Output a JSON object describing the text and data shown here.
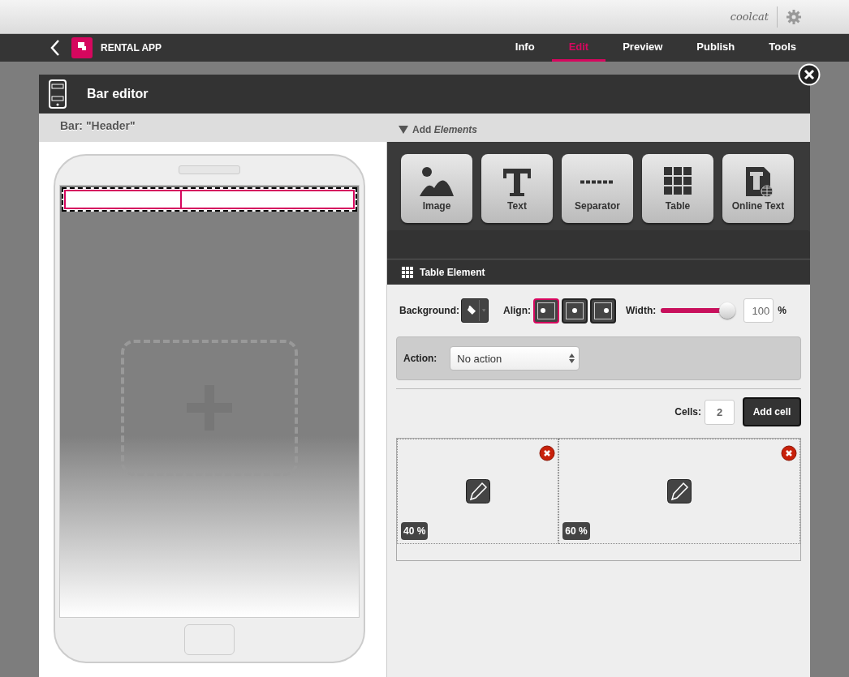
{
  "top_bar": {
    "user": "coolcat"
  },
  "app_bar": {
    "title": "RENTAL APP",
    "tabs": [
      {
        "label": "Info",
        "selected": false
      },
      {
        "label": "Edit",
        "selected": true
      },
      {
        "label": "Preview",
        "selected": false
      },
      {
        "label": "Publish",
        "selected": false
      },
      {
        "label": "Tools",
        "selected": false
      }
    ]
  },
  "editor": {
    "title": "Bar editor",
    "bar_label": "Bar: \"Header\"",
    "add_elements": "Add *Elements*",
    "elements": [
      {
        "kind": "image",
        "label": "Image"
      },
      {
        "kind": "text",
        "label": "Text"
      },
      {
        "kind": "separator",
        "label": "Separator"
      },
      {
        "kind": "table",
        "label": "Table"
      },
      {
        "kind": "online-text",
        "label": "Online Text"
      }
    ],
    "section_title": "Table Element",
    "background_label": "Background:",
    "align_label": "Align:",
    "align_options": [
      {
        "kind": "left",
        "selected": true
      },
      {
        "kind": "center",
        "selected": false
      },
      {
        "kind": "right",
        "selected": false
      }
    ],
    "width_label": "Width:",
    "width_slider": {
      "level": 1
    },
    "width_value": "100",
    "width_unit": "%",
    "action_label": "Action:",
    "action_value": "No action",
    "cells_label": "Cells:",
    "cells_value": "2",
    "add_cell_button": "Add cell",
    "cells": [
      {
        "width_label": "40 %",
        "level": 0.4
      },
      {
        "width_label": "60 %",
        "level": 0.6
      }
    ]
  }
}
